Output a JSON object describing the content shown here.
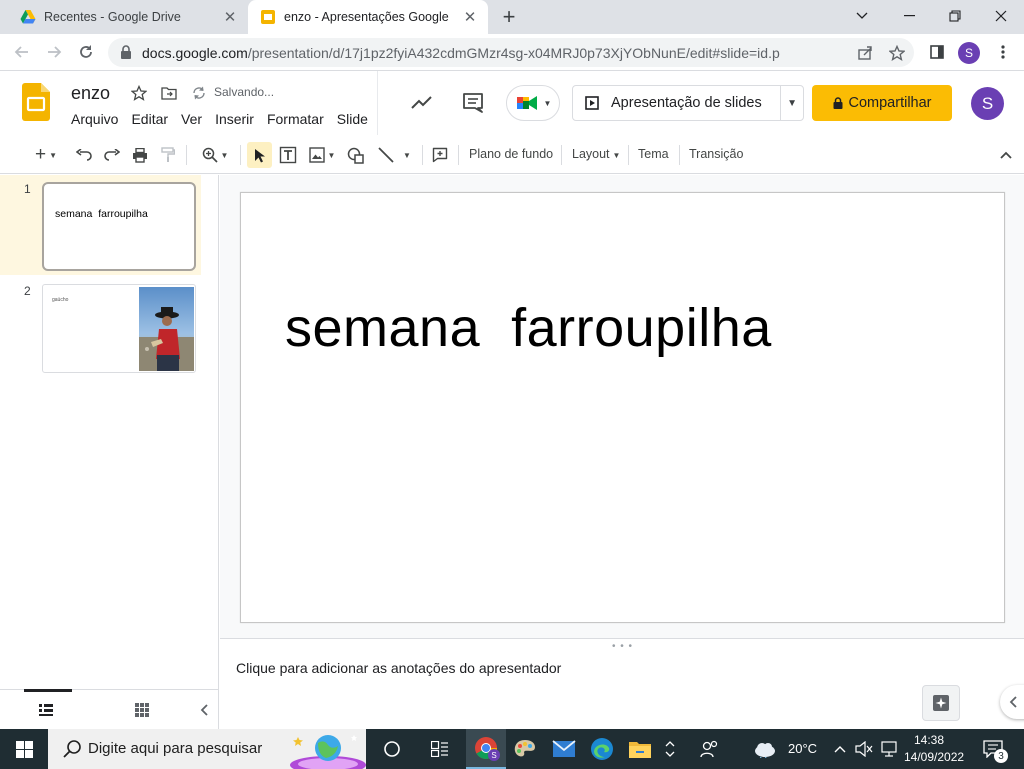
{
  "browser": {
    "tabs": [
      {
        "title": "Recentes - Google Drive",
        "active": false,
        "favicon": "google-drive-icon"
      },
      {
        "title": "enzo - Apresentações Google",
        "active": true,
        "favicon": "google-slides-icon"
      }
    ],
    "url_host": "docs.google.com",
    "url_path": "/presentation/d/17j1pz2fyiA432cdmGMzr4sg-x04MRJ0p73XjYObNunE/edit#slide=id.p",
    "profile_initial": "S"
  },
  "app": {
    "doc_title": "enzo",
    "save_status": "Salvando...",
    "menu": [
      "Arquivo",
      "Editar",
      "Ver",
      "Inserir",
      "Formatar",
      "Slide"
    ],
    "present_label": "Apresentação de slides",
    "share_label": "Compartilhar",
    "avatar_initial": "S",
    "brand_color": "#fbbc04"
  },
  "toolbar": {
    "background_label": "Plano de fundo",
    "layout_label": "Layout",
    "theme_label": "Tema",
    "transition_label": "Transição"
  },
  "filmstrip": {
    "slides": [
      {
        "number": "1",
        "title": "semana  farroupilha"
      },
      {
        "number": "2",
        "title": "gaúcho"
      }
    ]
  },
  "slide": {
    "title": "semana  farroupilha"
  },
  "notes": {
    "placeholder": "Clique para adicionar as anotações do apresentador"
  },
  "taskbar": {
    "search_placeholder": "Digite aqui para pesquisar",
    "weather": "20°C",
    "time": "14:38",
    "date": "14/09/2022",
    "notification_count": "3"
  }
}
